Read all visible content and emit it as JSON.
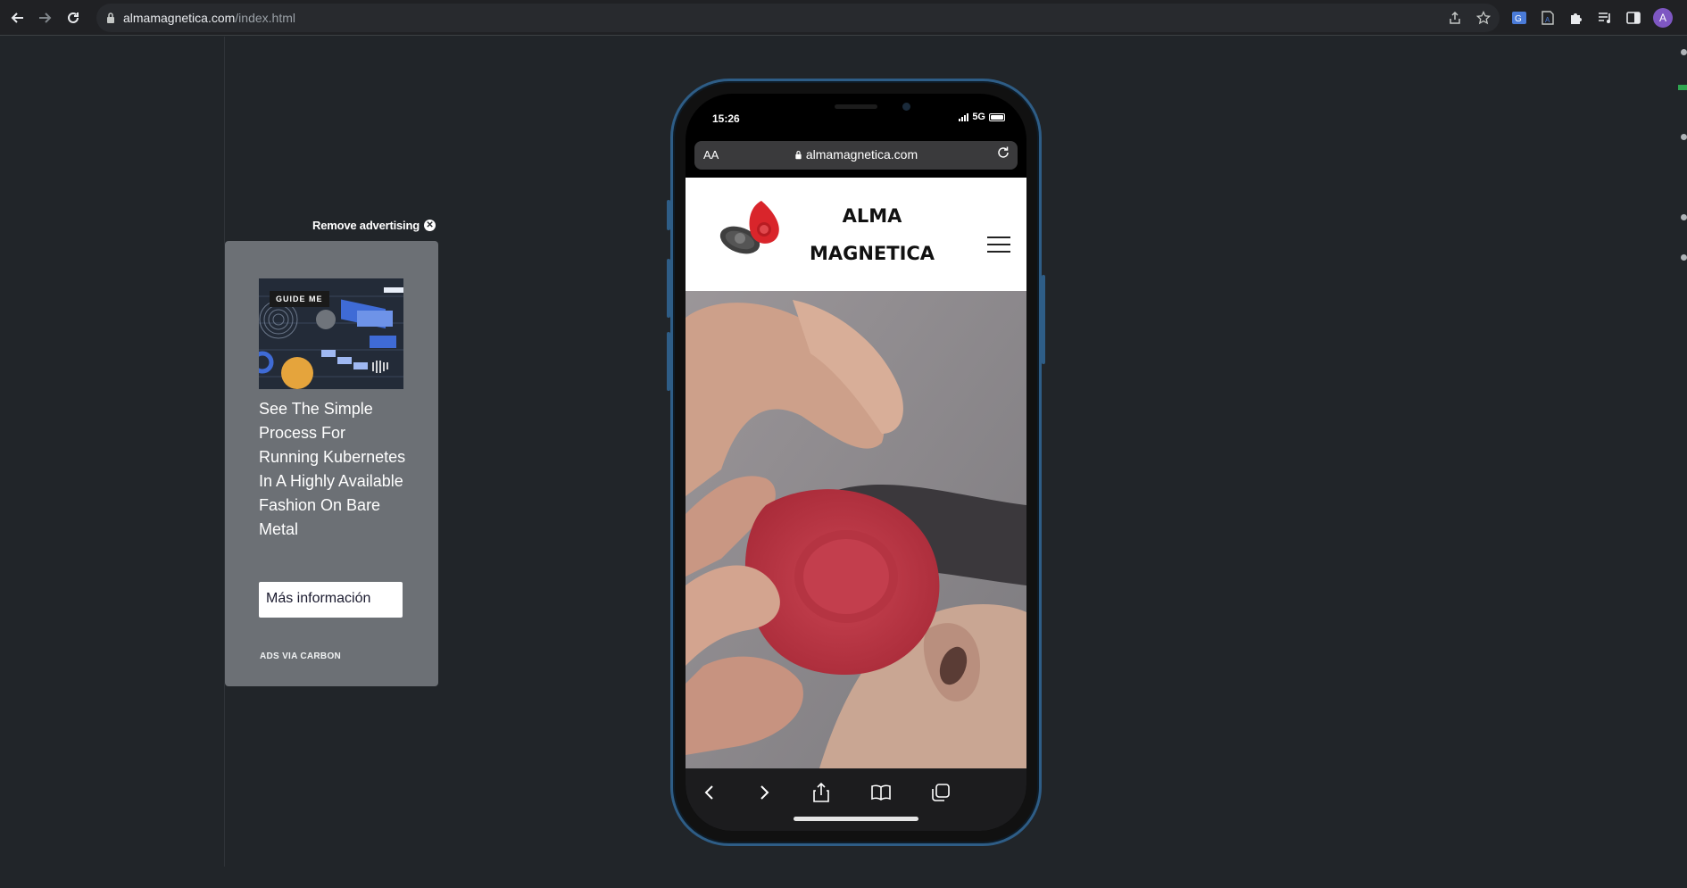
{
  "browser": {
    "url_host": "almamagnetica.com",
    "url_path": "/index.html",
    "avatar_letter": "A",
    "icons": {
      "back": "arrow-left-icon",
      "forward": "arrow-right-icon",
      "reload": "reload-icon",
      "share": "share-icon",
      "bookmark": "star-icon",
      "extensions": [
        "translate-icon",
        "reader-icon",
        "puzzle-icon",
        "media-icon",
        "side-panel-icon"
      ]
    }
  },
  "ad": {
    "remove_label": "Remove advertising",
    "image_badge": "GUIDE ME",
    "headline": "See The Simple Process For Running Kubernetes In A Highly Available Fashion On Bare Metal",
    "cta": "Más información",
    "via": "ADS VIA CARBON"
  },
  "phone": {
    "status": {
      "time": "15:26",
      "network": "5G"
    },
    "safari": {
      "text_size_label": "AA",
      "url": "almamagnetica.com"
    },
    "site": {
      "brand_line1": "ALMA",
      "brand_line2": "MAGNETICA"
    },
    "colors": {
      "frame": "#2e5d86",
      "logo_red": "#d9252b",
      "logo_dark": "#4a4a4a"
    }
  }
}
